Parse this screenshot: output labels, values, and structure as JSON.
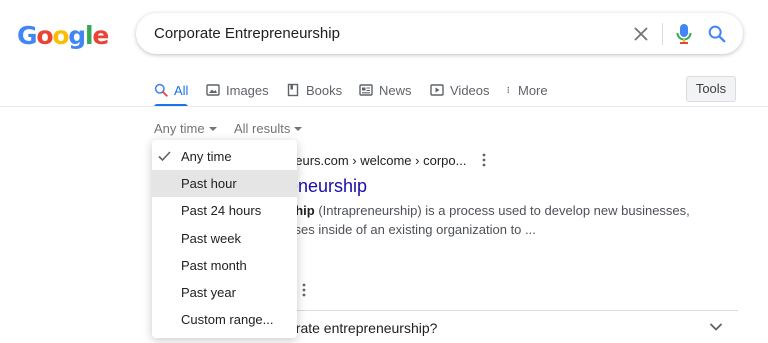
{
  "logo": {
    "letters": [
      {
        "ch": "G",
        "color": "#4285f4"
      },
      {
        "ch": "o",
        "color": "#ea4335"
      },
      {
        "ch": "o",
        "color": "#fbbc05"
      },
      {
        "ch": "g",
        "color": "#4285f4"
      },
      {
        "ch": "l",
        "color": "#34a853"
      },
      {
        "ch": "e",
        "color": "#ea4335"
      }
    ]
  },
  "search": {
    "query": "Corporate Entrepreneurship",
    "icons": [
      "close-icon",
      "mic-icon",
      "search-icon"
    ]
  },
  "tabs": [
    {
      "label": "All",
      "icon": "search-icon",
      "active": true
    },
    {
      "label": "Images",
      "icon": "image-icon",
      "active": false
    },
    {
      "label": "Books",
      "icon": "book-icon",
      "active": false
    },
    {
      "label": "News",
      "icon": "news-icon",
      "active": false
    },
    {
      "label": "Videos",
      "icon": "play-icon",
      "active": false
    },
    {
      "label": "More",
      "icon": "kebab-icon",
      "active": false
    }
  ],
  "tools_label": "Tools",
  "filters": {
    "time": "Any time",
    "results": "All results"
  },
  "dropdown": {
    "selected": "Any time",
    "hovered": "Past hour",
    "items": [
      "Any time",
      "Past hour",
      "Past 24 hours",
      "Past week",
      "Past month",
      "Past year",
      "Custom range..."
    ]
  },
  "result": {
    "url": "neurs.com › welcome › corpo...",
    "title": "eneurship",
    "snippet_bold": "ship",
    "snippet_line1_rest": " (Intrapreneurship) is a process used to develop new businesses,",
    "snippet_line2": "sses inside of an existing organization to ..."
  },
  "people_also_ask": {
    "question": "orate entrepreneurship?"
  },
  "colors": {
    "accent": "#1a73e8",
    "link": "#1a0dab",
    "hover_bg": "#e5e5e5"
  }
}
